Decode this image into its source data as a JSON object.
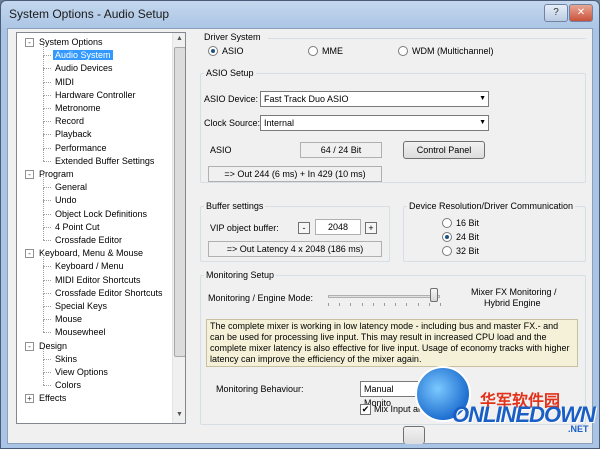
{
  "window": {
    "title": "System Options - Audio Setup",
    "help_label": "?",
    "close_label": "✕"
  },
  "tree": {
    "items": [
      {
        "label": "System Options",
        "level": 0,
        "expander": "-"
      },
      {
        "label": "Audio System",
        "level": 1,
        "selected": true
      },
      {
        "label": "Audio Devices",
        "level": 1
      },
      {
        "label": "MIDI",
        "level": 1
      },
      {
        "label": "Hardware Controller",
        "level": 1
      },
      {
        "label": "Metronome",
        "level": 1
      },
      {
        "label": "Record",
        "level": 1
      },
      {
        "label": "Playback",
        "level": 1
      },
      {
        "label": "Performance",
        "level": 1
      },
      {
        "label": "Extended Buffer Settings",
        "level": 1
      },
      {
        "label": "Program",
        "level": 0,
        "expander": "-"
      },
      {
        "label": "General",
        "level": 1
      },
      {
        "label": "Undo",
        "level": 1
      },
      {
        "label": "Object Lock Definitions",
        "level": 1
      },
      {
        "label": "4 Point Cut",
        "level": 1
      },
      {
        "label": "Crossfade Editor",
        "level": 1
      },
      {
        "label": "Keyboard, Menu & Mouse",
        "level": 0,
        "expander": "-"
      },
      {
        "label": "Keyboard / Menu",
        "level": 1
      },
      {
        "label": "MIDI Editor Shortcuts",
        "level": 1
      },
      {
        "label": "Crossfade Editor Shortcuts",
        "level": 1
      },
      {
        "label": "Special Keys",
        "level": 1
      },
      {
        "label": "Mouse",
        "level": 1
      },
      {
        "label": "Mousewheel",
        "level": 1
      },
      {
        "label": "Design",
        "level": 0,
        "expander": "-"
      },
      {
        "label": "Skins",
        "level": 1
      },
      {
        "label": "View Options",
        "level": 1
      },
      {
        "label": "Colors",
        "level": 1
      },
      {
        "label": "Effects",
        "level": 0,
        "expander": "+"
      }
    ]
  },
  "driver_system": {
    "label": "Driver System",
    "options": [
      "ASIO",
      "MME",
      "WDM (Multichannel)"
    ],
    "selected": "ASIO"
  },
  "asio_setup": {
    "label": "ASIO Setup",
    "device_label": "ASIO Device:",
    "device_value": "Fast Track Duo ASIO",
    "clock_label": "Clock Source:",
    "clock_value": "Internal",
    "asio_label": "ASIO",
    "format_value": "64 / 24 Bit",
    "control_panel_label": "Control Panel",
    "latency_value": "=> Out 244 (6 ms)  + In 429 (10 ms)"
  },
  "buffer_settings": {
    "label": "Buffer settings",
    "vip_label": "VIP object buffer:",
    "vip_value": "2048",
    "minus_label": "-",
    "plus_label": "+",
    "latency_value": "=> Out Latency 4 x 2048 (186 ms)"
  },
  "resolution": {
    "label": "Device Resolution/Driver Communication",
    "options": [
      "16 Bit",
      "24 Bit",
      "32 Bit"
    ],
    "selected": "24 Bit"
  },
  "monitoring": {
    "label": "Monitoring Setup",
    "mode_label": "Monitoring / Engine Mode:",
    "mode_value_line1": "Mixer FX Monitoring /",
    "mode_value_line2": "Hybrid Engine",
    "slider_position": 0.95,
    "description": "The complete mixer is working in low latency mode - including bus and master FX.- and can be used for processing live input.  This may result in increased CPU load and the complete mixer latency is also effective for live input. Usage of economy tracks with higher latency can improve the efficiency of the mixer again.",
    "behaviour_label": "Monitoring Behaviour:",
    "behaviour_value": "Manual Monito",
    "mix_input_label": "Mix Input an",
    "mix_input_checked": true
  },
  "watermark": {
    "cn": "华军软件园",
    "en": "ONLINEDOWN",
    "sub": ".NET"
  }
}
